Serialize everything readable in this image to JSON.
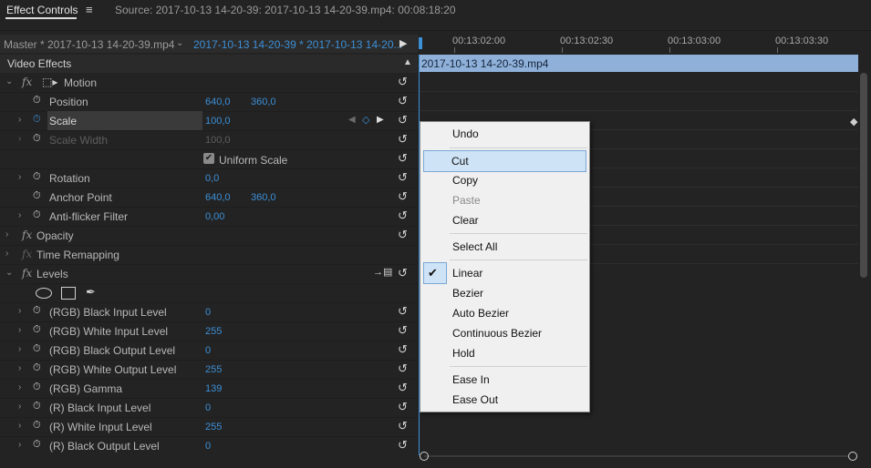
{
  "header": {
    "tab": "Effect Controls",
    "menu_icon": "hamburger-icon",
    "source": "Source: 2017-10-13 14-20-39: 2017-10-13 14-20-39.mp4: 00:08:18:20"
  },
  "clipbar": {
    "master": "Master * 2017-10-13 14-20-39.mp4",
    "clip": "2017-10-13 14-20-39 * 2017-10-13 14-20..."
  },
  "ruler": {
    "labels": [
      "00:13:02:00",
      "00:13:02:30",
      "00:13:03:00",
      "00:13:03:30"
    ]
  },
  "video_effects": {
    "label": "Video Effects"
  },
  "timeline_clip": {
    "label": "2017-10-13 14-20-39.mp4"
  },
  "rows": {
    "motion": "Motion",
    "position": {
      "name": "Position",
      "v1": "640,0",
      "v2": "360,0"
    },
    "scale": {
      "name": "Scale",
      "v1": "100,0"
    },
    "scale_width": {
      "name": "Scale Width",
      "v1": "100,0"
    },
    "uniform_scale": "Uniform Scale",
    "rotation": {
      "name": "Rotation",
      "v1": "0,0"
    },
    "anchor": {
      "name": "Anchor Point",
      "v1": "640,0",
      "v2": "360,0"
    },
    "antiflicker": {
      "name": "Anti-flicker Filter",
      "v1": "0,00"
    },
    "opacity": "Opacity",
    "time_remap": "Time Remapping",
    "levels": "Levels",
    "rgb_black_in": {
      "name": "(RGB) Black Input Level",
      "v1": "0"
    },
    "rgb_white_in": {
      "name": "(RGB) White Input Level",
      "v1": "255"
    },
    "rgb_black_out": {
      "name": "(RGB) Black Output Level",
      "v1": "0"
    },
    "rgb_white_out": {
      "name": "(RGB) White Output Level",
      "v1": "255"
    },
    "rgb_gamma": {
      "name": "(RGB) Gamma",
      "v1": "139"
    },
    "r_black_in": {
      "name": "(R) Black Input Level",
      "v1": "0"
    },
    "r_white_in": {
      "name": "(R) White Input Level",
      "v1": "255"
    },
    "r_black_out": {
      "name": "(R) Black Output Level",
      "v1": "0"
    }
  },
  "menu": {
    "items": [
      "Undo",
      "Cut",
      "Copy",
      "Paste",
      "Clear",
      "Select All",
      "Linear",
      "Bezier",
      "Auto Bezier",
      "Continuous Bezier",
      "Hold",
      "Ease In",
      "Ease Out"
    ]
  },
  "colors": {
    "accent": "#3d8fd6",
    "clip": "#8fb1d9",
    "menu_bg": "#f0f0f0",
    "menu_hl": "#cfe3f6"
  }
}
